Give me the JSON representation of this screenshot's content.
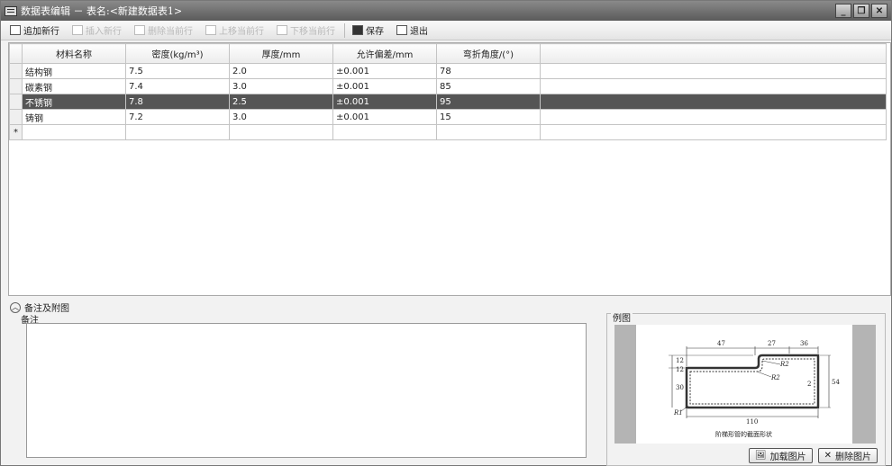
{
  "window": {
    "title": "数据表编辑 － 表名:<新建数据表1>",
    "minimize": "_",
    "restore": "❐",
    "close": "✕"
  },
  "toolbar": {
    "add_row": "追加新行",
    "insert_row": "插入新行",
    "delete_row": "删除当前行",
    "move_up": "上移当前行",
    "move_down": "下移当前行",
    "save": "保存",
    "exit": "退出"
  },
  "table": {
    "columns": [
      "材料名称",
      "密度(kg/m³)",
      "厚度/mm",
      "允许偏差/mm",
      "弯折角度/(°)"
    ],
    "rows": [
      [
        "结构钢",
        "7.5",
        "2.0",
        "±0.001",
        "78"
      ],
      [
        "碳素钢",
        "7.4",
        "3.0",
        "±0.001",
        "85"
      ],
      [
        "不锈钢",
        "7.8",
        "2.5",
        "±0.001",
        "95"
      ],
      [
        "铸钢",
        "7.2",
        "3.0",
        "±0.001",
        "15"
      ]
    ],
    "selected_row_index": 2,
    "new_row_marker": "*"
  },
  "notes": {
    "section_title": "备注及附图",
    "label": "备注",
    "value": ""
  },
  "example": {
    "label": "例图",
    "dims": {
      "top1": "47",
      "top2": "27",
      "top3": "36",
      "r2a": "R2",
      "r2b": "R2",
      "r1": "R1",
      "bottom": "110",
      "left1": "12",
      "left2": "12",
      "left3": "30",
      "right": "54",
      "inner": "2"
    },
    "caption": "阶梯形管的截面形状",
    "load_button": "加载图片",
    "delete_button": "删除图片"
  },
  "colors": {
    "titlebar": "#6e6e6e",
    "selected_row": "#555555"
  }
}
